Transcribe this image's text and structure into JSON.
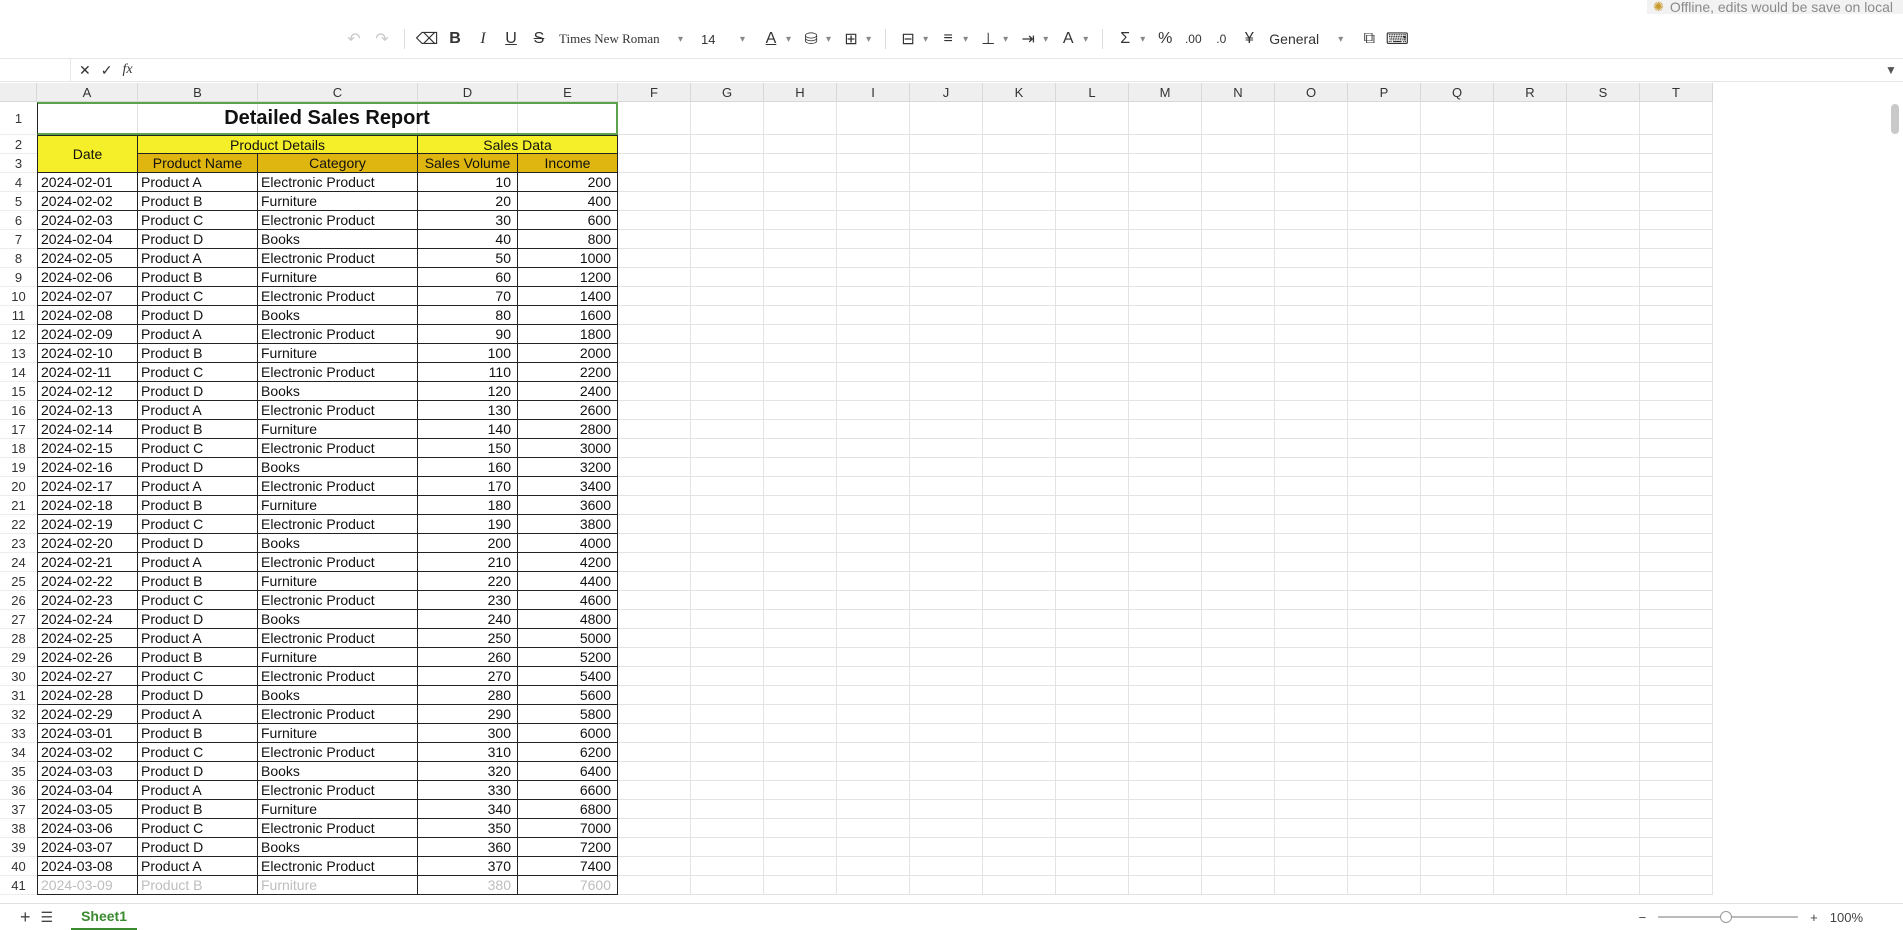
{
  "offline_notice": "Offline, edits would be save on local",
  "toolbar": {
    "font_family": "Times New Roman",
    "font_size": "14",
    "number_format": "General"
  },
  "formula_bar": {
    "fx": "fx",
    "cancel": "✕",
    "confirm": "✓"
  },
  "columns": [
    "A",
    "B",
    "C",
    "D",
    "E",
    "F",
    "G",
    "H",
    "I",
    "J",
    "K",
    "L",
    "M",
    "N",
    "O",
    "P",
    "Q",
    "R",
    "S",
    "T"
  ],
  "table": {
    "title": "Detailed Sales Report",
    "group_date": "Date",
    "group_product": "Product Details",
    "group_sales": "Sales Data",
    "h_product": "Product Name",
    "h_category": "Category",
    "h_volume": "Sales Volume",
    "h_income": "Income",
    "rows": [
      [
        "2024-02-01",
        "Product A",
        "Electronic Product",
        "10",
        "200"
      ],
      [
        "2024-02-02",
        "Product B",
        "Furniture",
        "20",
        "400"
      ],
      [
        "2024-02-03",
        "Product C",
        "Electronic Product",
        "30",
        "600"
      ],
      [
        "2024-02-04",
        "Product D",
        "Books",
        "40",
        "800"
      ],
      [
        "2024-02-05",
        "Product A",
        "Electronic Product",
        "50",
        "1000"
      ],
      [
        "2024-02-06",
        "Product B",
        "Furniture",
        "60",
        "1200"
      ],
      [
        "2024-02-07",
        "Product C",
        "Electronic Product",
        "70",
        "1400"
      ],
      [
        "2024-02-08",
        "Product D",
        "Books",
        "80",
        "1600"
      ],
      [
        "2024-02-09",
        "Product A",
        "Electronic Product",
        "90",
        "1800"
      ],
      [
        "2024-02-10",
        "Product B",
        "Furniture",
        "100",
        "2000"
      ],
      [
        "2024-02-11",
        "Product C",
        "Electronic Product",
        "110",
        "2200"
      ],
      [
        "2024-02-12",
        "Product D",
        "Books",
        "120",
        "2400"
      ],
      [
        "2024-02-13",
        "Product A",
        "Electronic Product",
        "130",
        "2600"
      ],
      [
        "2024-02-14",
        "Product B",
        "Furniture",
        "140",
        "2800"
      ],
      [
        "2024-02-15",
        "Product C",
        "Electronic Product",
        "150",
        "3000"
      ],
      [
        "2024-02-16",
        "Product D",
        "Books",
        "160",
        "3200"
      ],
      [
        "2024-02-17",
        "Product A",
        "Electronic Product",
        "170",
        "3400"
      ],
      [
        "2024-02-18",
        "Product B",
        "Furniture",
        "180",
        "3600"
      ],
      [
        "2024-02-19",
        "Product C",
        "Electronic Product",
        "190",
        "3800"
      ],
      [
        "2024-02-20",
        "Product D",
        "Books",
        "200",
        "4000"
      ],
      [
        "2024-02-21",
        "Product A",
        "Electronic Product",
        "210",
        "4200"
      ],
      [
        "2024-02-22",
        "Product B",
        "Furniture",
        "220",
        "4400"
      ],
      [
        "2024-02-23",
        "Product C",
        "Electronic Product",
        "230",
        "4600"
      ],
      [
        "2024-02-24",
        "Product D",
        "Books",
        "240",
        "4800"
      ],
      [
        "2024-02-25",
        "Product A",
        "Electronic Product",
        "250",
        "5000"
      ],
      [
        "2024-02-26",
        "Product B",
        "Furniture",
        "260",
        "5200"
      ],
      [
        "2024-02-27",
        "Product C",
        "Electronic Product",
        "270",
        "5400"
      ],
      [
        "2024-02-28",
        "Product D",
        "Books",
        "280",
        "5600"
      ],
      [
        "2024-02-29",
        "Product A",
        "Electronic Product",
        "290",
        "5800"
      ],
      [
        "2024-03-01",
        "Product B",
        "Furniture",
        "300",
        "6000"
      ],
      [
        "2024-03-02",
        "Product C",
        "Electronic Product",
        "310",
        "6200"
      ],
      [
        "2024-03-03",
        "Product D",
        "Books",
        "320",
        "6400"
      ],
      [
        "2024-03-04",
        "Product A",
        "Electronic Product",
        "330",
        "6600"
      ],
      [
        "2024-03-05",
        "Product B",
        "Furniture",
        "340",
        "6800"
      ],
      [
        "2024-03-06",
        "Product C",
        "Electronic Product",
        "350",
        "7000"
      ],
      [
        "2024-03-07",
        "Product D",
        "Books",
        "360",
        "7200"
      ],
      [
        "2024-03-08",
        "Product A",
        "Electronic Product",
        "370",
        "7400"
      ],
      [
        "2024-03-09",
        "Product B",
        "Furniture",
        "380",
        "7600"
      ]
    ]
  },
  "sheet_tab": "Sheet1",
  "zoom": "100%"
}
